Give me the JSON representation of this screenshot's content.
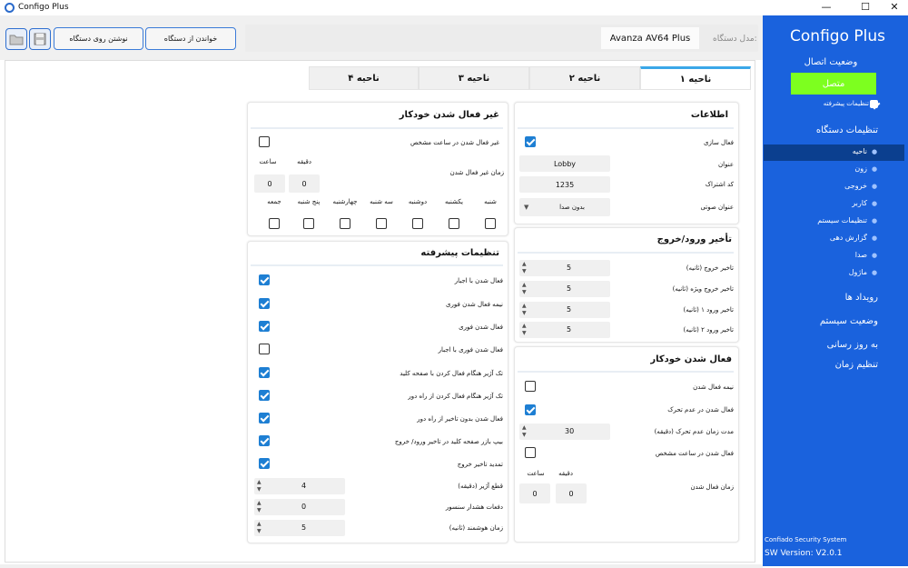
{
  "window": {
    "title": "Configo Plus",
    "minimize": "—",
    "maximize": "☐",
    "close": "✕"
  },
  "toolbar": {
    "read": "خواندن از دستگاه",
    "write": "نوشتن روی دستگاه",
    "device_label": "مدل دستگاه:",
    "device_value": "Avanza AV64 Plus"
  },
  "sidebar": {
    "app_title": "Configo Plus",
    "status_title": "وضعیت اتصال",
    "status_value": "متصل",
    "status_color": "#7dff1f",
    "advanced": "تنظیمات پیشرفته",
    "device_settings": "تنظیمات دستگاه",
    "items": [
      "ناحیه",
      "زون",
      "خروجی",
      "کاربر",
      "تنظیمات سیستم",
      "گزارش دهی",
      "صدا",
      "ماژول"
    ],
    "events": "رویداد ها",
    "system_status": "وضعیت سیستم",
    "update": "به روز رسانی",
    "time_setting": "تنظیم زمان",
    "company": "Confiado Security System",
    "version": "SW Version: V2.0.1"
  },
  "tabs": [
    "ناحیه ۱",
    "ناحیه ۲",
    "ناحیه ۳",
    "ناحیه ۴"
  ],
  "info": {
    "title": "اطلاعات",
    "enable": "فعال سازی",
    "name_lbl": "عنوان",
    "name_val": "Lobby",
    "code_lbl": "کد اشتراک",
    "code_val": "1235",
    "voice_lbl": "عنوان صوتی",
    "voice_val": "بدون صدا"
  },
  "delay": {
    "title": "تأخیر ورود/خروج",
    "rows": [
      {
        "l": "تاخیر خروج (ثانیه)",
        "v": "5"
      },
      {
        "l": "تاخیر خروج ویژه (ثانیه)",
        "v": "5"
      },
      {
        "l": "تاخیر ورود ۱ (ثانیه)",
        "v": "5"
      },
      {
        "l": "تاخیر ورود ۲ (ثانیه)",
        "v": "5"
      }
    ]
  },
  "autoarm": {
    "title": "فعال شدن خودکار",
    "half": "نیمه فعال شدن",
    "inactivity": "فعال شدن در عدم تحرک",
    "inact_time_lbl": "مدت زمان عدم تحرک (دقیقه)",
    "inact_time_val": "30",
    "at_time": "فعال شدن در ساعت مشخص",
    "minute": "دقیقه",
    "hour": "ساعت",
    "time_lbl": "زمان فعال شدن",
    "min_val": "0",
    "hour_val": "0"
  },
  "autodisarm": {
    "title": "غیر فعال شدن خودکار",
    "at_time": "غیر فعال شدن در ساعت مشخص",
    "minute": "دقیقه",
    "hour": "ساعت",
    "time_lbl": "زمان غیر فعال شدن",
    "min_val": "0",
    "hour_val": "0",
    "days": [
      "شنبه",
      "یکشنبه",
      "دوشنبه",
      "سه شنبه",
      "چهارشنبه",
      "پنج شنبه",
      "جمعه"
    ]
  },
  "advanced": {
    "title": "تنظیمات پیشرفته",
    "checks": [
      {
        "l": "فعال شدن با اجبار",
        "on": true
      },
      {
        "l": "نیمه فعال شدن فوری",
        "on": true
      },
      {
        "l": "فعال شدن فوری",
        "on": true
      },
      {
        "l": "فعال شدن فوری با اجبار",
        "on": false
      },
      {
        "l": "تک آژیر هنگام فعال کردن با صفحه کلید",
        "on": true
      },
      {
        "l": "تک آژیر هنگام فعال کردن از راه دور",
        "on": true
      },
      {
        "l": "فعال شدن بدون تاخیر از راه دور",
        "on": true
      },
      {
        "l": "بیپ بازر صفحه کلید در تاخیر ورود/ خروج",
        "on": true
      },
      {
        "l": "تمدید تاخیر خروج",
        "on": true
      }
    ],
    "spins": [
      {
        "l": "قطع آژیر (دقیقه)",
        "v": "4"
      },
      {
        "l": "دفعات هشدار سنسور",
        "v": "0"
      },
      {
        "l": "زمان هوشمند (ثانیه)",
        "v": "5"
      }
    ]
  }
}
